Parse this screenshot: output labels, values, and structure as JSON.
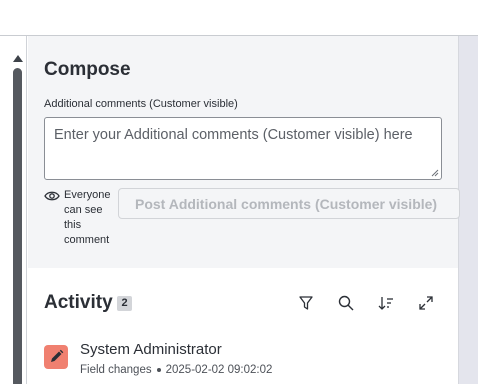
{
  "compose": {
    "title": "Compose",
    "field_label": "Additional comments (Customer visible)",
    "placeholder": "Enter your Additional comments (Customer visible) here",
    "visibility_note": "Everyone can see this comment",
    "post_button_label": "Post Additional comments (Customer visible)"
  },
  "activity": {
    "title": "Activity",
    "count": "2",
    "tools": [
      "filter-icon",
      "search-icon",
      "sort-icon",
      "expand-icon"
    ],
    "entries": [
      {
        "author": "System Administrator",
        "type": "Field changes",
        "timestamp": "2025-02-02 09:02:02",
        "avatar_icon": "pencil-icon",
        "avatar_color": "#f08070"
      }
    ]
  },
  "colors": {
    "panel_bg": "#f4f5f7",
    "text": "#2b2f36",
    "disabled_text": "#b4b7bc",
    "avatar": "#f08070"
  }
}
